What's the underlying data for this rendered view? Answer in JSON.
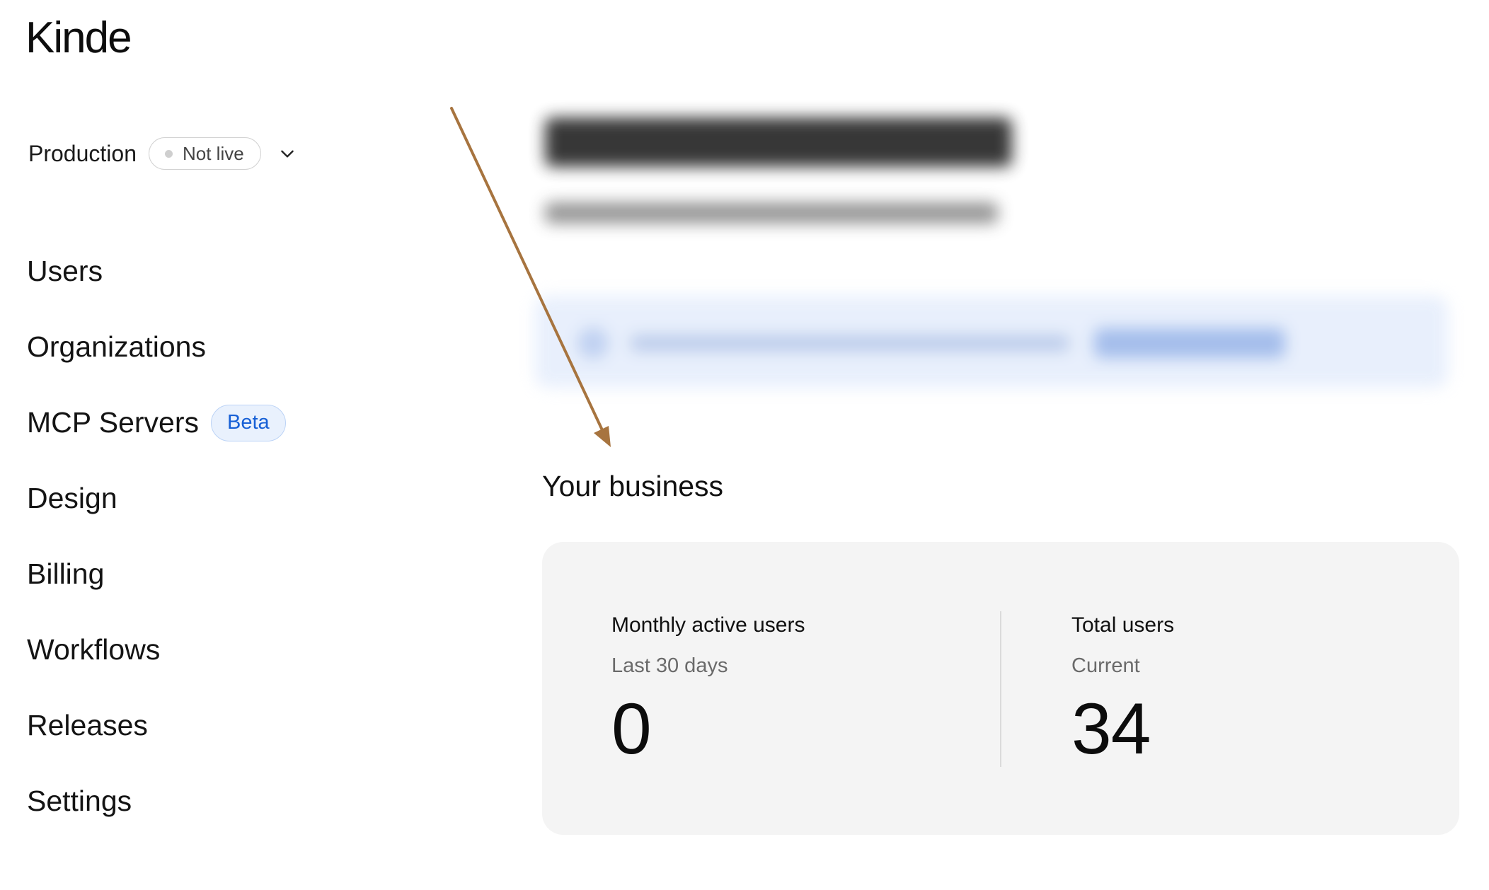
{
  "app": {
    "logo": "Kinde"
  },
  "environment": {
    "name": "Production",
    "status": "Not live"
  },
  "sidebar": {
    "items": [
      {
        "label": "Users"
      },
      {
        "label": "Organizations"
      },
      {
        "label": "MCP Servers",
        "badge": "Beta"
      },
      {
        "label": "Design"
      },
      {
        "label": "Billing"
      },
      {
        "label": "Workflows"
      },
      {
        "label": "Releases"
      },
      {
        "label": "Settings"
      }
    ]
  },
  "main": {
    "section_title": "Your business",
    "stats": [
      {
        "label": "Monthly active users",
        "sublabel": "Last 30 days",
        "value": "0"
      },
      {
        "label": "Total users",
        "sublabel": "Current",
        "value": "34"
      }
    ]
  },
  "colors": {
    "accent": "#1760d6",
    "annotation_arrow": "#a7743f",
    "card_background": "#f4f4f4"
  }
}
